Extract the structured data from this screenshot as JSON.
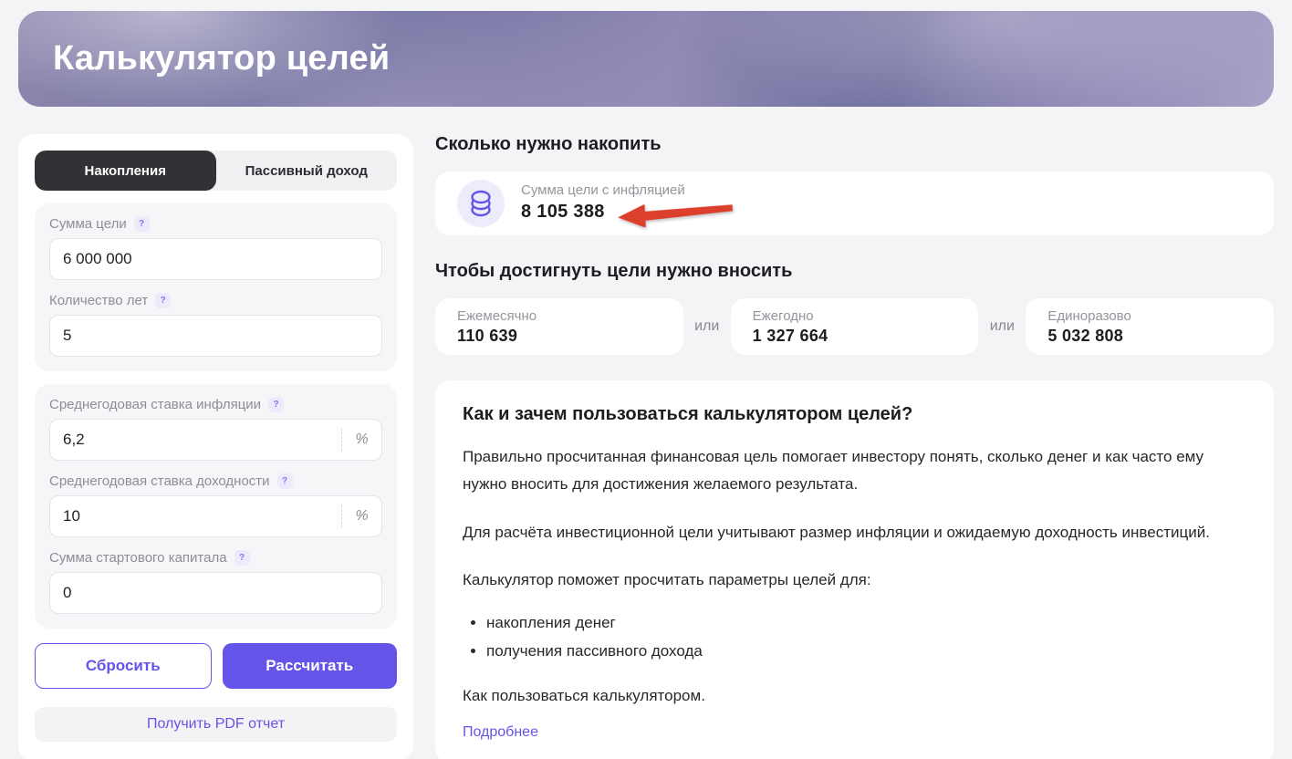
{
  "header": {
    "title": "Калькулятор целей"
  },
  "icons": {
    "help": "?"
  },
  "sidebar": {
    "tabs": [
      {
        "label": "Накопления"
      },
      {
        "label": "Пассивный доход"
      }
    ],
    "fields": [
      {
        "label": "Сумма цели",
        "value": "6 000 000"
      },
      {
        "label": "Количество лет",
        "value": "5"
      },
      {
        "label": "Среднегодовая ставка инфляции",
        "value": "6,2",
        "suffix": "%"
      },
      {
        "label": "Среднегодовая ставка доходности",
        "value": "10",
        "suffix": "%"
      },
      {
        "label": "Сумма стартового капитала",
        "value": "0"
      }
    ],
    "reset_label": "Сбросить",
    "calculate_label": "Рассчитать",
    "pdf_label": "Получить PDF отчет"
  },
  "main": {
    "result_heading": "Сколько нужно накопить",
    "result": {
      "label": "Сумма цели с инфляцией",
      "value": "8 105 388"
    },
    "contribute_heading": "Чтобы достигнуть цели нужно вносить",
    "contribute": {
      "separator": "или",
      "cards": [
        {
          "label": "Ежемесячно",
          "value": "110 639"
        },
        {
          "label": "Ежегодно",
          "value": "1 327 664"
        },
        {
          "label": "Единоразово",
          "value": "5 032 808"
        }
      ]
    },
    "info": {
      "heading": "Как и зачем пользоваться калькулятором целей?",
      "paragraph1": "Правильно просчитанная финансовая цель помогает инвестору понять, сколько денег и как часто ему нужно вносить для достижения желаемого результата.",
      "paragraph2": "Для расчёта инвестиционной цели учитывают размер инфляции и ожидаемую доходность инвестиций.",
      "list_intro": "Калькулятор поможет просчитать параметры целей для:",
      "bullets": [
        "накопления денег",
        "получения пассивного дохода"
      ],
      "footer": "Как пользоваться калькулятором.",
      "link": "Подробнее"
    }
  },
  "colors": {
    "accent": "#6554e8",
    "arrow": "#dc3f2c"
  }
}
